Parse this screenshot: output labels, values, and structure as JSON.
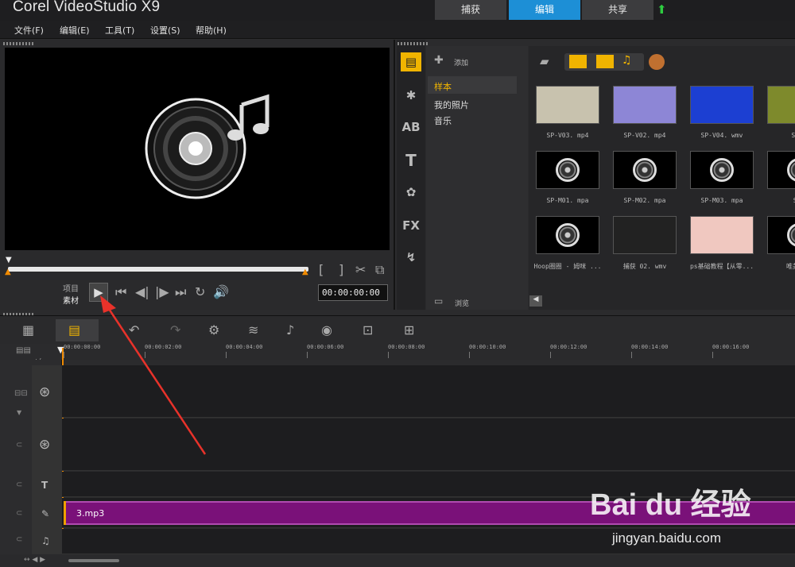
{
  "app": {
    "title": "Corel VideoStudio X9"
  },
  "mode_tabs": [
    {
      "label": "捕获"
    },
    {
      "label": "编辑"
    },
    {
      "label": "共享"
    }
  ],
  "menu": [
    {
      "label": "文件(F)"
    },
    {
      "label": "编辑(E)"
    },
    {
      "label": "工具(T)"
    },
    {
      "label": "设置(S)"
    },
    {
      "label": "帮助(H)"
    }
  ],
  "player": {
    "mode_project": "项目",
    "mode_clip": "素材",
    "timecode": "00:00:00:00"
  },
  "library": {
    "add_label": "添加",
    "nav": [
      {
        "label": "样本"
      },
      {
        "label": "我的照片"
      },
      {
        "label": "音乐"
      }
    ],
    "browse_label": "浏览",
    "items": [
      {
        "caption": "SP-V03. mp4",
        "color": "#c8c2ae"
      },
      {
        "caption": "SP-V02. mp4",
        "color": "#8d86d6"
      },
      {
        "caption": "SP-V04. wmv",
        "color": "#1c3fd2"
      },
      {
        "caption": "SP-I",
        "color": "#7e8a2c"
      },
      {
        "caption": "SP-M01. mpa"
      },
      {
        "caption": "SP-M02. mpa"
      },
      {
        "caption": "SP-M03. mpa"
      },
      {
        "caption": "SP-"
      },
      {
        "caption": "Hoop圈圈 - 姆咪 ..."
      },
      {
        "caption": "捕获 02. wmv",
        "color": "#222"
      },
      {
        "caption": "ps基础教程【从零...",
        "color": "#f0c8c0"
      },
      {
        "caption": "唯美旋律"
      }
    ]
  },
  "timeline": {
    "ruler": [
      "00:00:00:00",
      "00:00:02:00",
      "00:00:04:00",
      "00:00:06:00",
      "00:00:08:00",
      "00:00:10:00",
      "00:00:12:00",
      "00:00:14:00",
      "00:00:16:00"
    ],
    "audio_clip": "3.mp3",
    "zoom_label": "+/-"
  },
  "watermark": {
    "brand": "Bai du 经验",
    "url": "jingyan.baidu.com"
  }
}
